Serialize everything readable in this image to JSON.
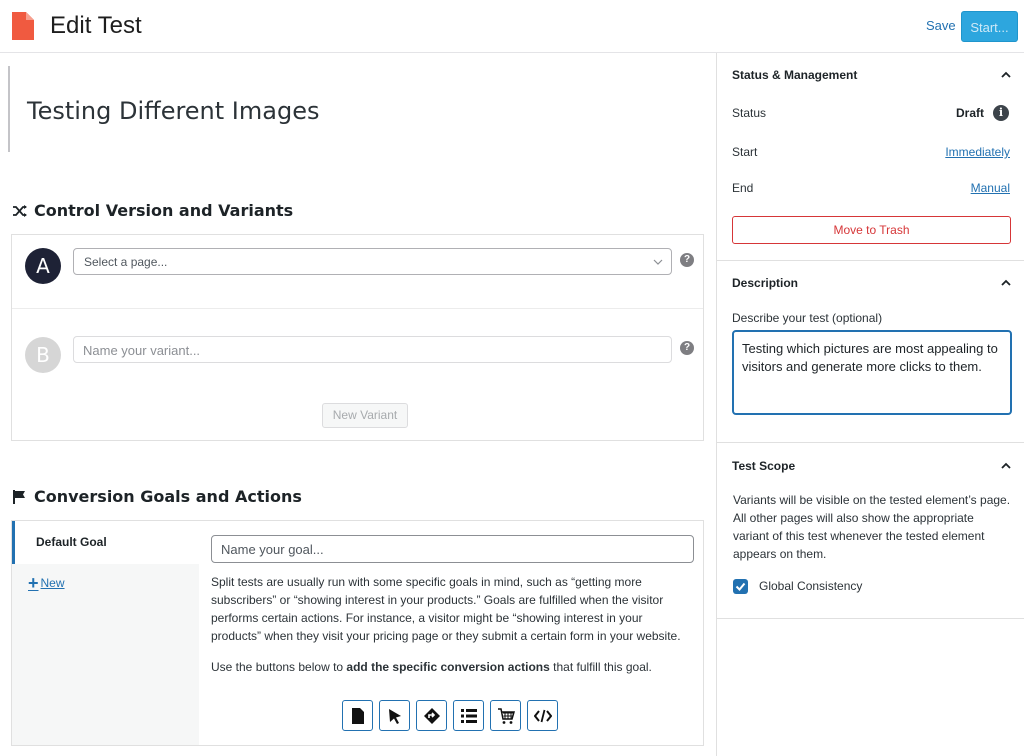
{
  "header": {
    "title": "Edit Test",
    "save_label": "Save",
    "start_label": "Start..."
  },
  "test": {
    "title": "Testing Different Images"
  },
  "variants_section": {
    "heading": "Control Version and Variants",
    "variant_a_letter": "A",
    "variant_a_select_placeholder": "Select a page...",
    "variant_b_letter": "B",
    "variant_b_name_placeholder": "Name your variant...",
    "new_variant_label": "New Variant",
    "help_glyph": "?"
  },
  "goals_section": {
    "heading": "Conversion Goals and Actions",
    "default_goal_tab": "Default Goal",
    "new_goal_label": "New",
    "goal_name_placeholder": "Name your goal...",
    "description": "Split tests are usually run with some specific goals in mind, such as “getting more subscribers” or “showing interest in your products.” Goals are fulfilled when the visitor performs certain actions. For instance, a visitor might be “showing interest in your products” when they visit your pricing page or they submit a certain form in your website.",
    "instruction_prefix": "Use the buttons below to ",
    "instruction_bold": "add the specific conversion actions",
    "instruction_suffix": " that fulfill this goal.",
    "action_icons": [
      "page-icon",
      "click-icon",
      "direction-icon",
      "list-icon",
      "cart-icon",
      "code-icon"
    ]
  },
  "status_panel": {
    "heading": "Status & Management",
    "status_label": "Status",
    "status_value": "Draft",
    "info_glyph": "i",
    "start_label": "Start",
    "start_value": "Immediately",
    "end_label": "End",
    "end_value": "Manual",
    "trash_label": "Move to Trash"
  },
  "description_panel": {
    "heading": "Description",
    "field_label": "Describe your test (optional)",
    "field_value": "Testing which pictures are most appealing to visitors and generate more clicks to them."
  },
  "scope_panel": {
    "heading": "Test Scope",
    "text": "Variants will be visible on the tested element’s page. All other pages will also show the appropriate variant of this test whenever the tested element appears on them.",
    "checkbox_label": "Global Consistency",
    "checkbox_checked": true
  },
  "colors": {
    "accent": "#2271b1",
    "start_button": "#2da6de",
    "danger": "#d63638",
    "doc_icon": "#f05a40"
  }
}
